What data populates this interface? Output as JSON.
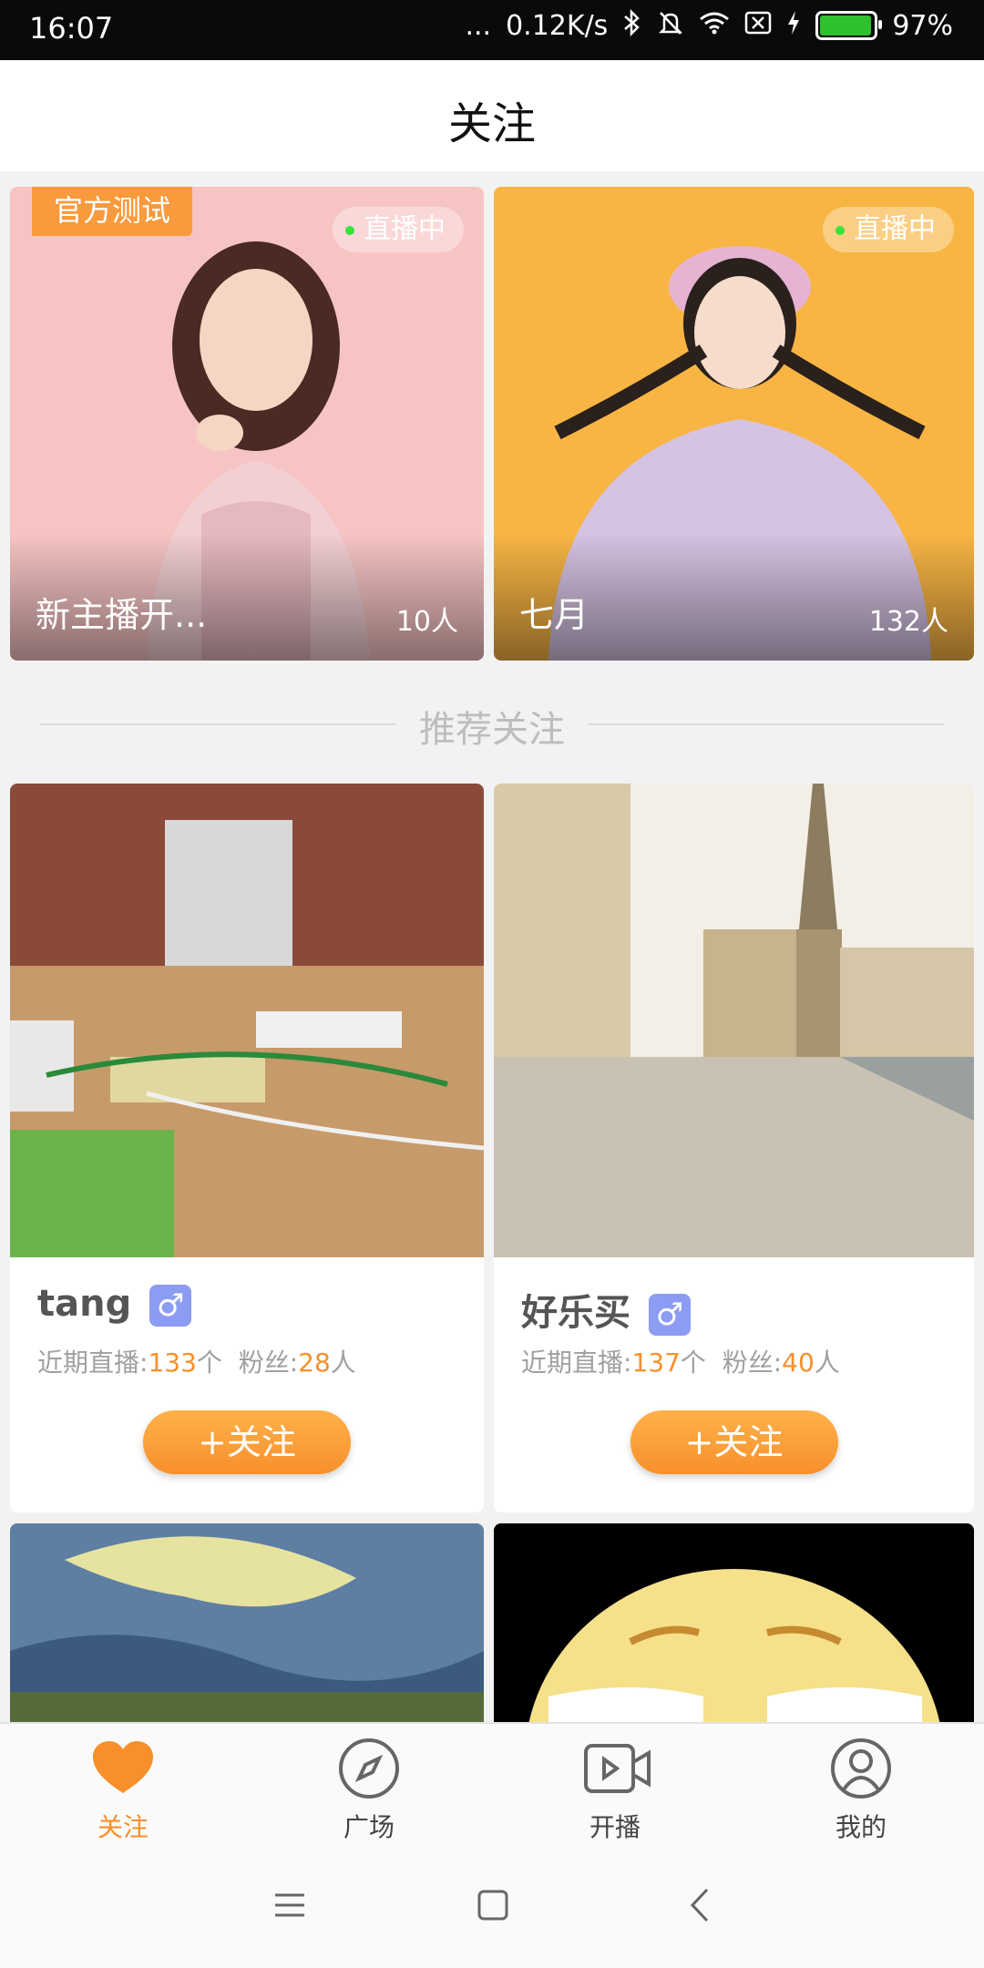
{
  "status_bar": {
    "time": "16:07",
    "more": "...",
    "speed": "0.12K/s",
    "battery": "97%",
    "battery_level": 0.97,
    "icons": [
      "bluetooth-icon",
      "mute-icon",
      "wifi-icon",
      "sim-icon",
      "charging-icon",
      "battery-icon"
    ]
  },
  "header": {
    "title": "关注"
  },
  "live_cards": [
    {
      "tag": "官方测试",
      "status": "直播中",
      "name": "新主播开...",
      "count": "10人"
    },
    {
      "status": "直播中",
      "name": "七月",
      "count": "132人"
    }
  ],
  "section": {
    "title": "推荐关注"
  },
  "recommend": [
    {
      "name": "tang",
      "gender": "♂",
      "live_label": "近期直播:",
      "live_count": "133",
      "live_unit": "个",
      "fans_label": "粉丝:",
      "fans_count": "28",
      "fans_unit": "人",
      "button": "+关注"
    },
    {
      "name": "好乐买",
      "gender": "♂",
      "live_label": "近期直播:",
      "live_count": "137",
      "live_unit": "个",
      "fans_label": "粉丝:",
      "fans_count": "40",
      "fans_unit": "人",
      "button": "+关注"
    }
  ],
  "bottom_nav": [
    {
      "label": "关注",
      "icon": "heart-icon",
      "active": true
    },
    {
      "label": "广场",
      "icon": "compass-icon"
    },
    {
      "label": "开播",
      "icon": "video-icon"
    },
    {
      "label": "我的",
      "icon": "user-icon"
    }
  ],
  "colors": {
    "accent": "#f7902c",
    "gender_badge": "#8c9cf2",
    "live_dot": "#38e238"
  }
}
